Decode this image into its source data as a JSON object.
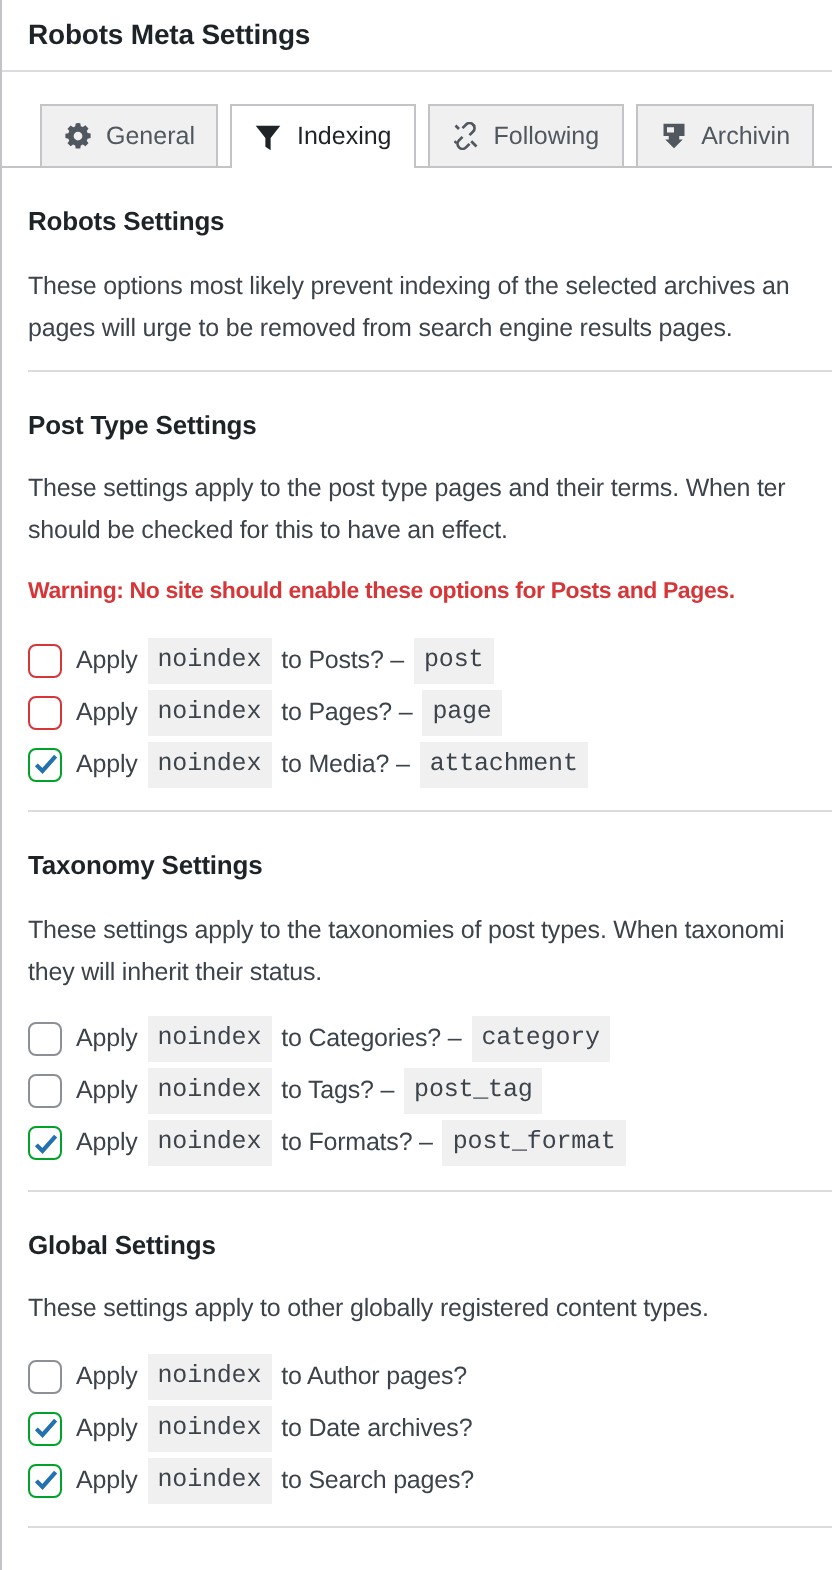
{
  "panel": {
    "title": "Robots Meta Settings"
  },
  "tabs": [
    {
      "label": "General",
      "selected": false
    },
    {
      "label": "Indexing",
      "selected": true
    },
    {
      "label": "Following",
      "selected": false
    },
    {
      "label": "Archivin",
      "selected": false
    }
  ],
  "sections": [
    {
      "heading": "Robots Settings",
      "lines": [
        "These options most likely prevent indexing of the selected archives an",
        "pages will urge to be removed from search engine results pages."
      ]
    },
    {
      "heading": "Post Type Settings",
      "lines": [
        "These settings apply to the post type pages and their terms. When ter",
        "should be checked for this to have an effect."
      ],
      "warning": "Warning: No site should enable these options for Posts and Pages.",
      "options": [
        {
          "prefix": "Apply",
          "code": "noindex",
          "suffix": "to Posts? –",
          "type_code": "post",
          "checked": false,
          "color": "#d63638"
        },
        {
          "prefix": "Apply",
          "code": "noindex",
          "suffix": "to Pages? –",
          "type_code": "page",
          "checked": false,
          "color": "#d63638"
        },
        {
          "prefix": "Apply",
          "code": "noindex",
          "suffix": "to Media? –",
          "type_code": "attachment",
          "checked": true,
          "color": "#00a32a"
        }
      ]
    },
    {
      "heading": "Taxonomy Settings",
      "lines": [
        "These settings apply to the taxonomies of post types. When taxonomi",
        "they will inherit their status."
      ],
      "options": [
        {
          "prefix": "Apply",
          "code": "noindex",
          "suffix": "to Categories? –",
          "type_code": "category",
          "checked": false,
          "color": "#8c8f94"
        },
        {
          "prefix": "Apply",
          "code": "noindex",
          "suffix": "to Tags? –",
          "type_code": "post_tag",
          "checked": false,
          "color": "#8c8f94"
        },
        {
          "prefix": "Apply",
          "code": "noindex",
          "suffix": "to Formats? –",
          "type_code": "post_format",
          "checked": true,
          "color": "#00a32a"
        }
      ]
    },
    {
      "heading": "Global Settings",
      "lines": [
        "These settings apply to other globally registered content types."
      ],
      "options": [
        {
          "prefix": "Apply",
          "code": "noindex",
          "suffix": "to Author pages?",
          "checked": false,
          "color": "#8c8f94"
        },
        {
          "prefix": "Apply",
          "code": "noindex",
          "suffix": "to Date archives?",
          "checked": true,
          "color": "#00a32a"
        },
        {
          "prefix": "Apply",
          "code": "noindex",
          "suffix": "to Search pages?",
          "checked": true,
          "color": "#00a32a"
        }
      ]
    }
  ]
}
